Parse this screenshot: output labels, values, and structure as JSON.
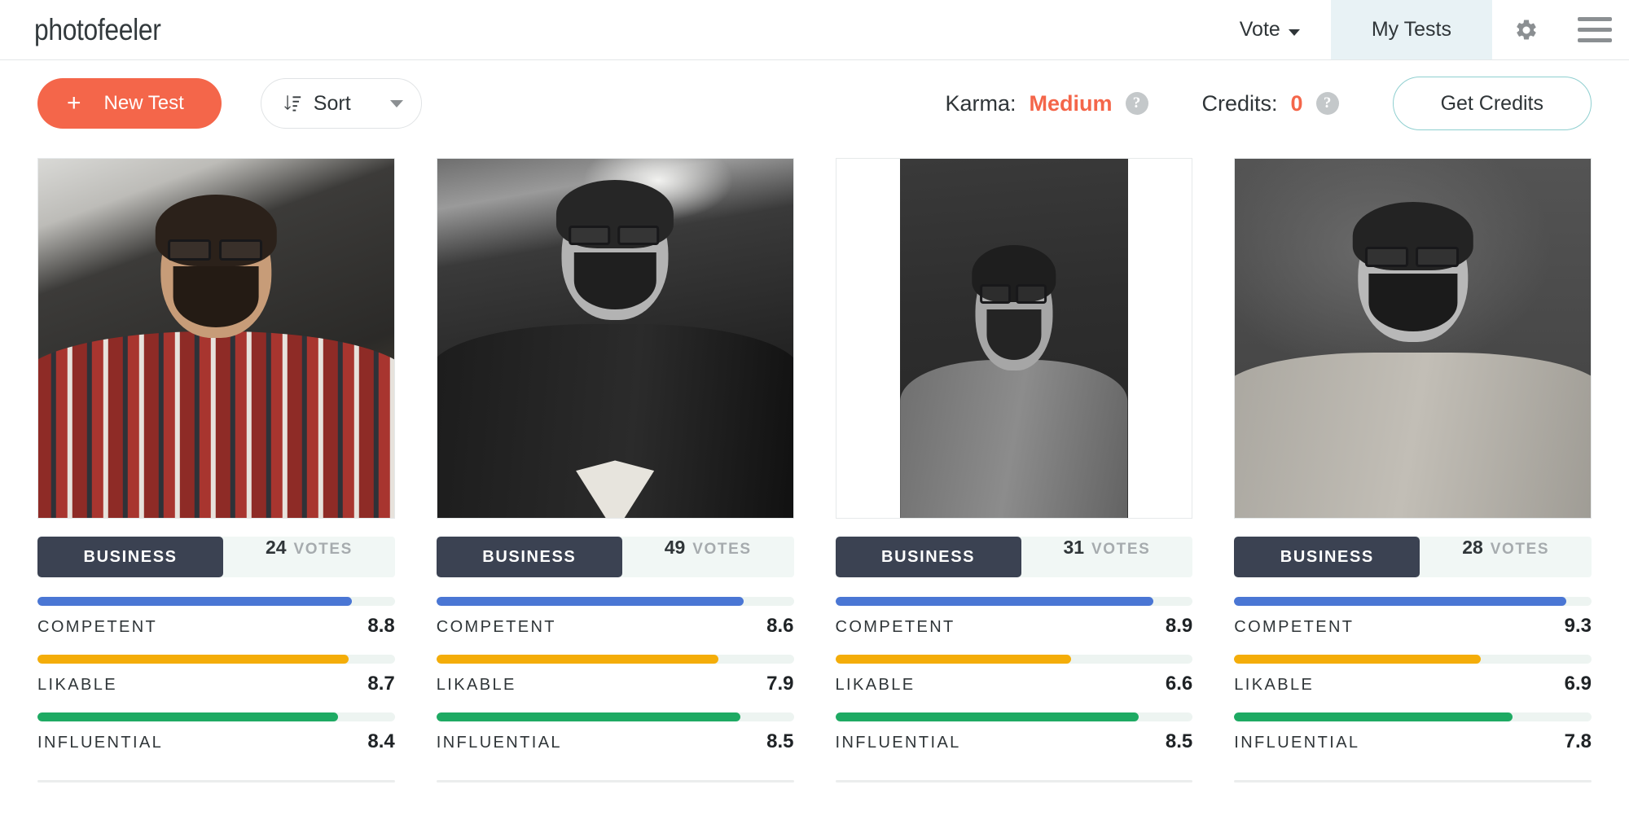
{
  "header": {
    "brand": "photofeeler",
    "nav": {
      "vote_label": "Vote",
      "my_tests_label": "My Tests",
      "settings_icon": "gear-icon",
      "menu_icon": "hamburger-icon"
    }
  },
  "toolbar": {
    "new_test_label": "New Test",
    "new_test_plus": "+",
    "sort_label": "Sort",
    "karma_label": "Karma:",
    "karma_value": "Medium",
    "karma_help": "?",
    "credits_label": "Credits:",
    "credits_value": "0",
    "credits_help": "?",
    "get_credits_label": "Get Credits",
    "accent_color": "#f4664a",
    "get_credits_border": "#8fcfd0"
  },
  "score_meta": {
    "labels": [
      "COMPETENT",
      "LIKABLE",
      "INFLUENTIAL"
    ],
    "colors": [
      "#4a76d4",
      "#f4ad09",
      "#1eaa63"
    ],
    "votes_word": "VOTES",
    "max": 10
  },
  "cards": [
    {
      "photo_alt": "man in red plaid shirt with glasses in office",
      "photo_fit": "wide",
      "photo_style": "ph-p1",
      "torso": "t1",
      "head": "h1",
      "hair": "hr1",
      "beard": "bd1",
      "glasses": "gl1",
      "collar": false,
      "type_label": "BUSINESS",
      "votes": "24",
      "scores": [
        {
          "label": "COMPETENT",
          "value": "8.8",
          "pct": 88
        },
        {
          "label": "LIKABLE",
          "value": "8.7",
          "pct": 87
        },
        {
          "label": "INFLUENTIAL",
          "value": "8.4",
          "pct": 84
        }
      ]
    },
    {
      "photo_alt": "black and white portrait of man in dark jacket",
      "photo_fit": "wide",
      "photo_style": "ph-p2",
      "torso": "t2",
      "head": "h2",
      "hair": "hr2",
      "beard": "bd2",
      "glasses": "gl2",
      "collar": true,
      "type_label": "BUSINESS",
      "votes": "49",
      "scores": [
        {
          "label": "COMPETENT",
          "value": "8.6",
          "pct": 86
        },
        {
          "label": "LIKABLE",
          "value": "7.9",
          "pct": 79
        },
        {
          "label": "INFLUENTIAL",
          "value": "8.5",
          "pct": 85
        }
      ]
    },
    {
      "photo_alt": "black and white portrait of man against dark backdrop",
      "photo_fit": "tall",
      "photo_style": "ph-p3",
      "torso": "t3",
      "head": "h3",
      "hair": "hr3",
      "beard": "bd3",
      "glasses": "gl3",
      "collar": false,
      "type_label": "BUSINESS",
      "votes": "31",
      "scores": [
        {
          "label": "COMPETENT",
          "value": "8.9",
          "pct": 89
        },
        {
          "label": "LIKABLE",
          "value": "6.6",
          "pct": 66
        },
        {
          "label": "INFLUENTIAL",
          "value": "8.5",
          "pct": 85
        }
      ]
    },
    {
      "photo_alt": "black and white portrait of man in light button-down shirt",
      "photo_fit": "wide",
      "photo_style": "ph-p4",
      "torso": "t4",
      "head": "h4",
      "hair": "hr4",
      "beard": "bd4",
      "glasses": "gl4",
      "collar": false,
      "type_label": "BUSINESS",
      "votes": "28",
      "scores": [
        {
          "label": "COMPETENT",
          "value": "9.3",
          "pct": 93
        },
        {
          "label": "LIKABLE",
          "value": "6.9",
          "pct": 69
        },
        {
          "label": "INFLUENTIAL",
          "value": "7.8",
          "pct": 78
        }
      ]
    }
  ]
}
